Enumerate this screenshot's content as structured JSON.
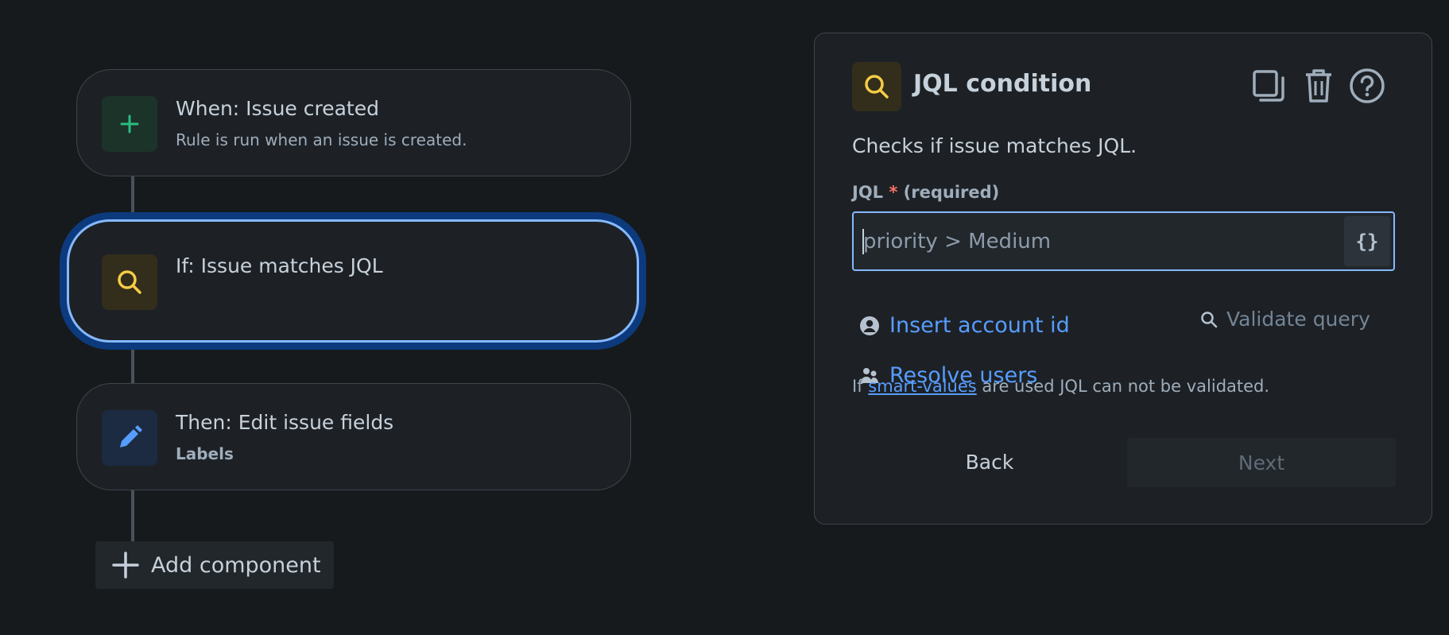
{
  "flow": {
    "trigger": {
      "title": "When: Issue created",
      "subtitle": "Rule is run when an issue is created.",
      "icon": "plus-icon",
      "accent": "#2abb7f"
    },
    "condition": {
      "title": "If: Issue matches JQL",
      "icon": "search-icon",
      "accent": "#f5cd47",
      "selected": true
    },
    "action": {
      "title": "Then: Edit issue fields",
      "subtitle": "Labels",
      "icon": "pencil-icon",
      "accent": "#579dff"
    },
    "add_component_label": "Add component"
  },
  "panel": {
    "title": "JQL condition",
    "icon": "search-icon",
    "header_actions": [
      "duplicate-icon",
      "trash-icon",
      "help-icon"
    ],
    "description": "Checks if issue matches JQL.",
    "field": {
      "label": "JQL",
      "required_marker": "*",
      "required_text": "(required)",
      "value": "",
      "placeholder": "priority > Medium",
      "smart_values_button": "{}"
    },
    "insert_account_id": "Insert account id",
    "resolve_users": "Resolve users",
    "validate_query": "Validate query",
    "hint": {
      "prefix": "If",
      "link": "smart-values",
      "suffix": "are used JQL can not be validated."
    },
    "back_label": "Back",
    "next_label": "Next"
  }
}
